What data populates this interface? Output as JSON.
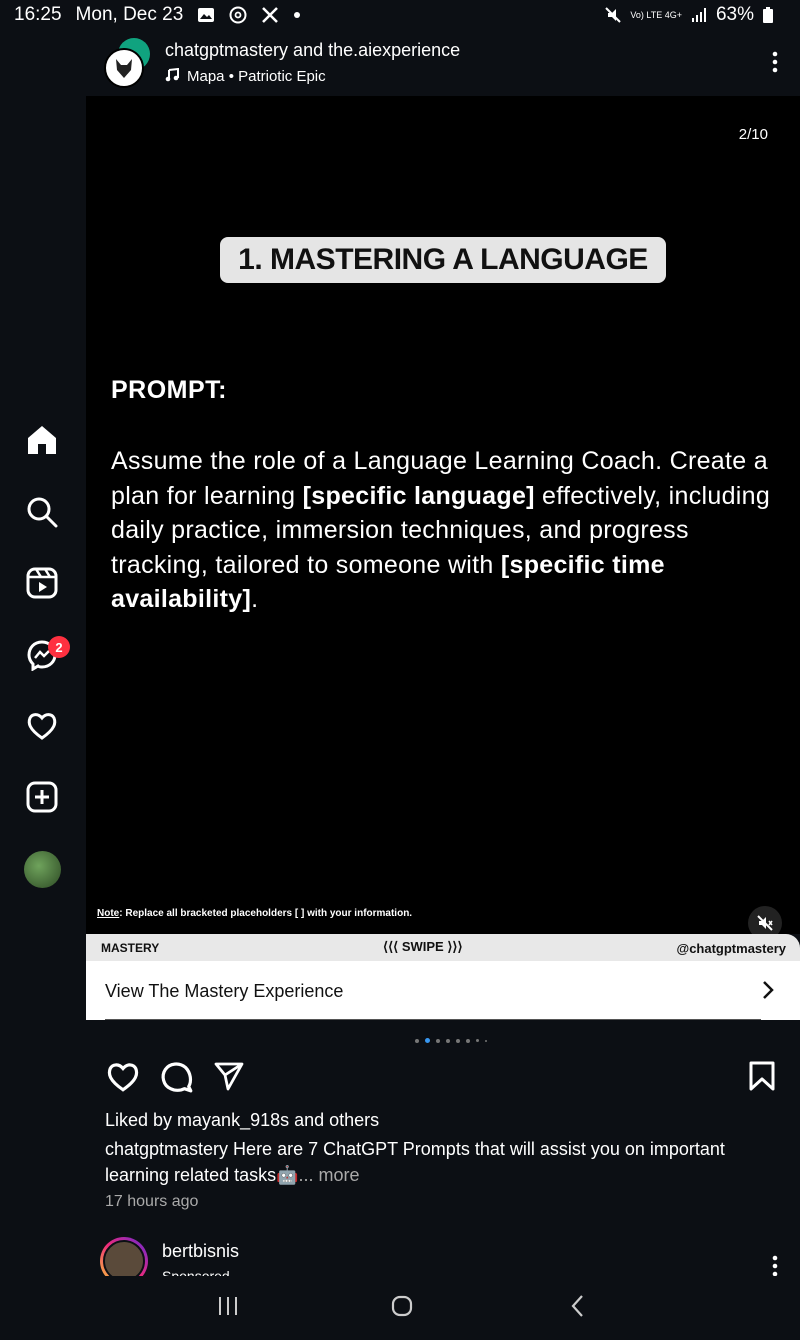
{
  "status_bar": {
    "time": "16:25",
    "date": "Mon, Dec 23",
    "network": "Vo) LTE 4G+",
    "battery": "63%"
  },
  "sidebar": {
    "items": [
      {
        "name": "home-icon"
      },
      {
        "name": "search-icon"
      },
      {
        "name": "reels-icon"
      },
      {
        "name": "messenger-icon"
      },
      {
        "name": "heart-icon"
      },
      {
        "name": "create-icon"
      },
      {
        "name": "profile-icon"
      }
    ],
    "messenger_badge": "2"
  },
  "post": {
    "users": "chatgptmastery and the.aiexperience",
    "music": "Mapa • Patriotic Epic",
    "counter": "2/10",
    "slide": {
      "title": "1. MASTERING A LANGUAGE",
      "prompt_label": "PROMPT:",
      "body_part1": "Assume the role of a Language Learning Coach. Create a plan for learning ",
      "body_bold1": "[specific language]",
      "body_part2": " effectively, including daily practice, immersion techniques, and progress tracking, tailored to someone with ",
      "body_bold2": "[specific time availability]",
      "body_part3": ".",
      "note_label": "Note",
      "note_text": ": Replace all bracketed placeholders [ ] with your information."
    },
    "strip": {
      "left": "MASTERY",
      "center": "⟨⟨⟨ SWIPE ⟩⟩⟩",
      "right": "@chatgptmastery"
    },
    "cta_label": "View The Mastery Experience",
    "liked_by": "Liked by mayank_918s and others",
    "caption": "chatgptmastery Here are 7 ChatGPT Prompts that will assist you on important learning related tasks🤖",
    "caption_more": "... more",
    "time_ago": "17 hours ago"
  },
  "next_post": {
    "user": "bertbisnis",
    "sub": "Sponsored"
  },
  "colors": {
    "background": "#0c0f14",
    "badge": "#ff3040",
    "active_dot": "#3897f0"
  }
}
